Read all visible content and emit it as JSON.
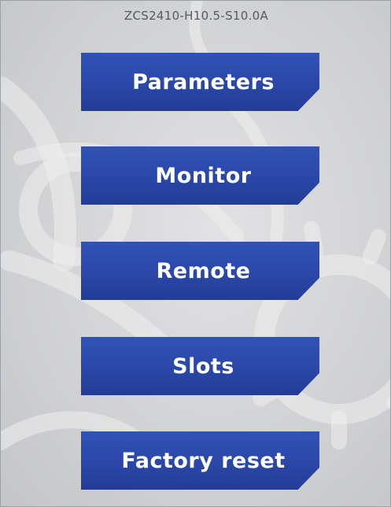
{
  "header": {
    "device_id": "ZCS2410-H10.5-S10.0A"
  },
  "menu": {
    "items": [
      {
        "label": "Parameters"
      },
      {
        "label": "Monitor"
      },
      {
        "label": "Remote"
      },
      {
        "label": "Slots"
      },
      {
        "label": "Factory reset"
      }
    ]
  },
  "colors": {
    "background": "#d3d4d6",
    "button": "#2a47a8",
    "button_text": "#ffffff",
    "device_id_text": "#555a60"
  }
}
